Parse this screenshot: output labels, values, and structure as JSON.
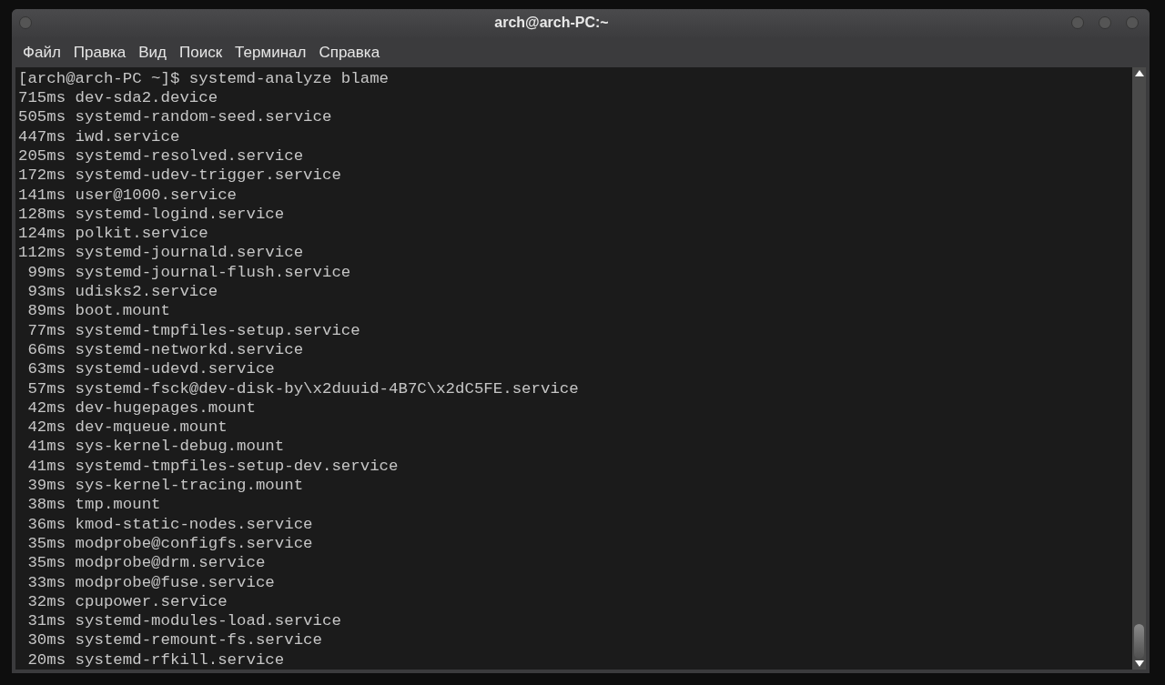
{
  "window": {
    "title": "arch@arch-PC:~"
  },
  "menu": [
    "Файл",
    "Правка",
    "Вид",
    "Поиск",
    "Терминал",
    "Справка"
  ],
  "terminal": {
    "lines": [
      "[arch@arch-PC ~]$ systemd-analyze blame",
      "715ms dev-sda2.device",
      "505ms systemd-random-seed.service",
      "447ms iwd.service",
      "205ms systemd-resolved.service",
      "172ms systemd-udev-trigger.service",
      "141ms user@1000.service",
      "128ms systemd-logind.service",
      "124ms polkit.service",
      "112ms systemd-journald.service",
      " 99ms systemd-journal-flush.service",
      " 93ms udisks2.service",
      " 89ms boot.mount",
      " 77ms systemd-tmpfiles-setup.service",
      " 66ms systemd-networkd.service",
      " 63ms systemd-udevd.service",
      " 57ms systemd-fsck@dev-disk-by\\x2duuid-4B7C\\x2dC5FE.service",
      " 42ms dev-hugepages.mount",
      " 42ms dev-mqueue.mount",
      " 41ms sys-kernel-debug.mount",
      " 41ms systemd-tmpfiles-setup-dev.service",
      " 39ms sys-kernel-tracing.mount",
      " 38ms tmp.mount",
      " 36ms kmod-static-nodes.service",
      " 35ms modprobe@configfs.service",
      " 35ms modprobe@drm.service",
      " 33ms modprobe@fuse.service",
      " 32ms cpupower.service",
      " 31ms systemd-modules-load.service",
      " 30ms systemd-remount-fs.service",
      " 20ms systemd-rfkill.service"
    ]
  }
}
